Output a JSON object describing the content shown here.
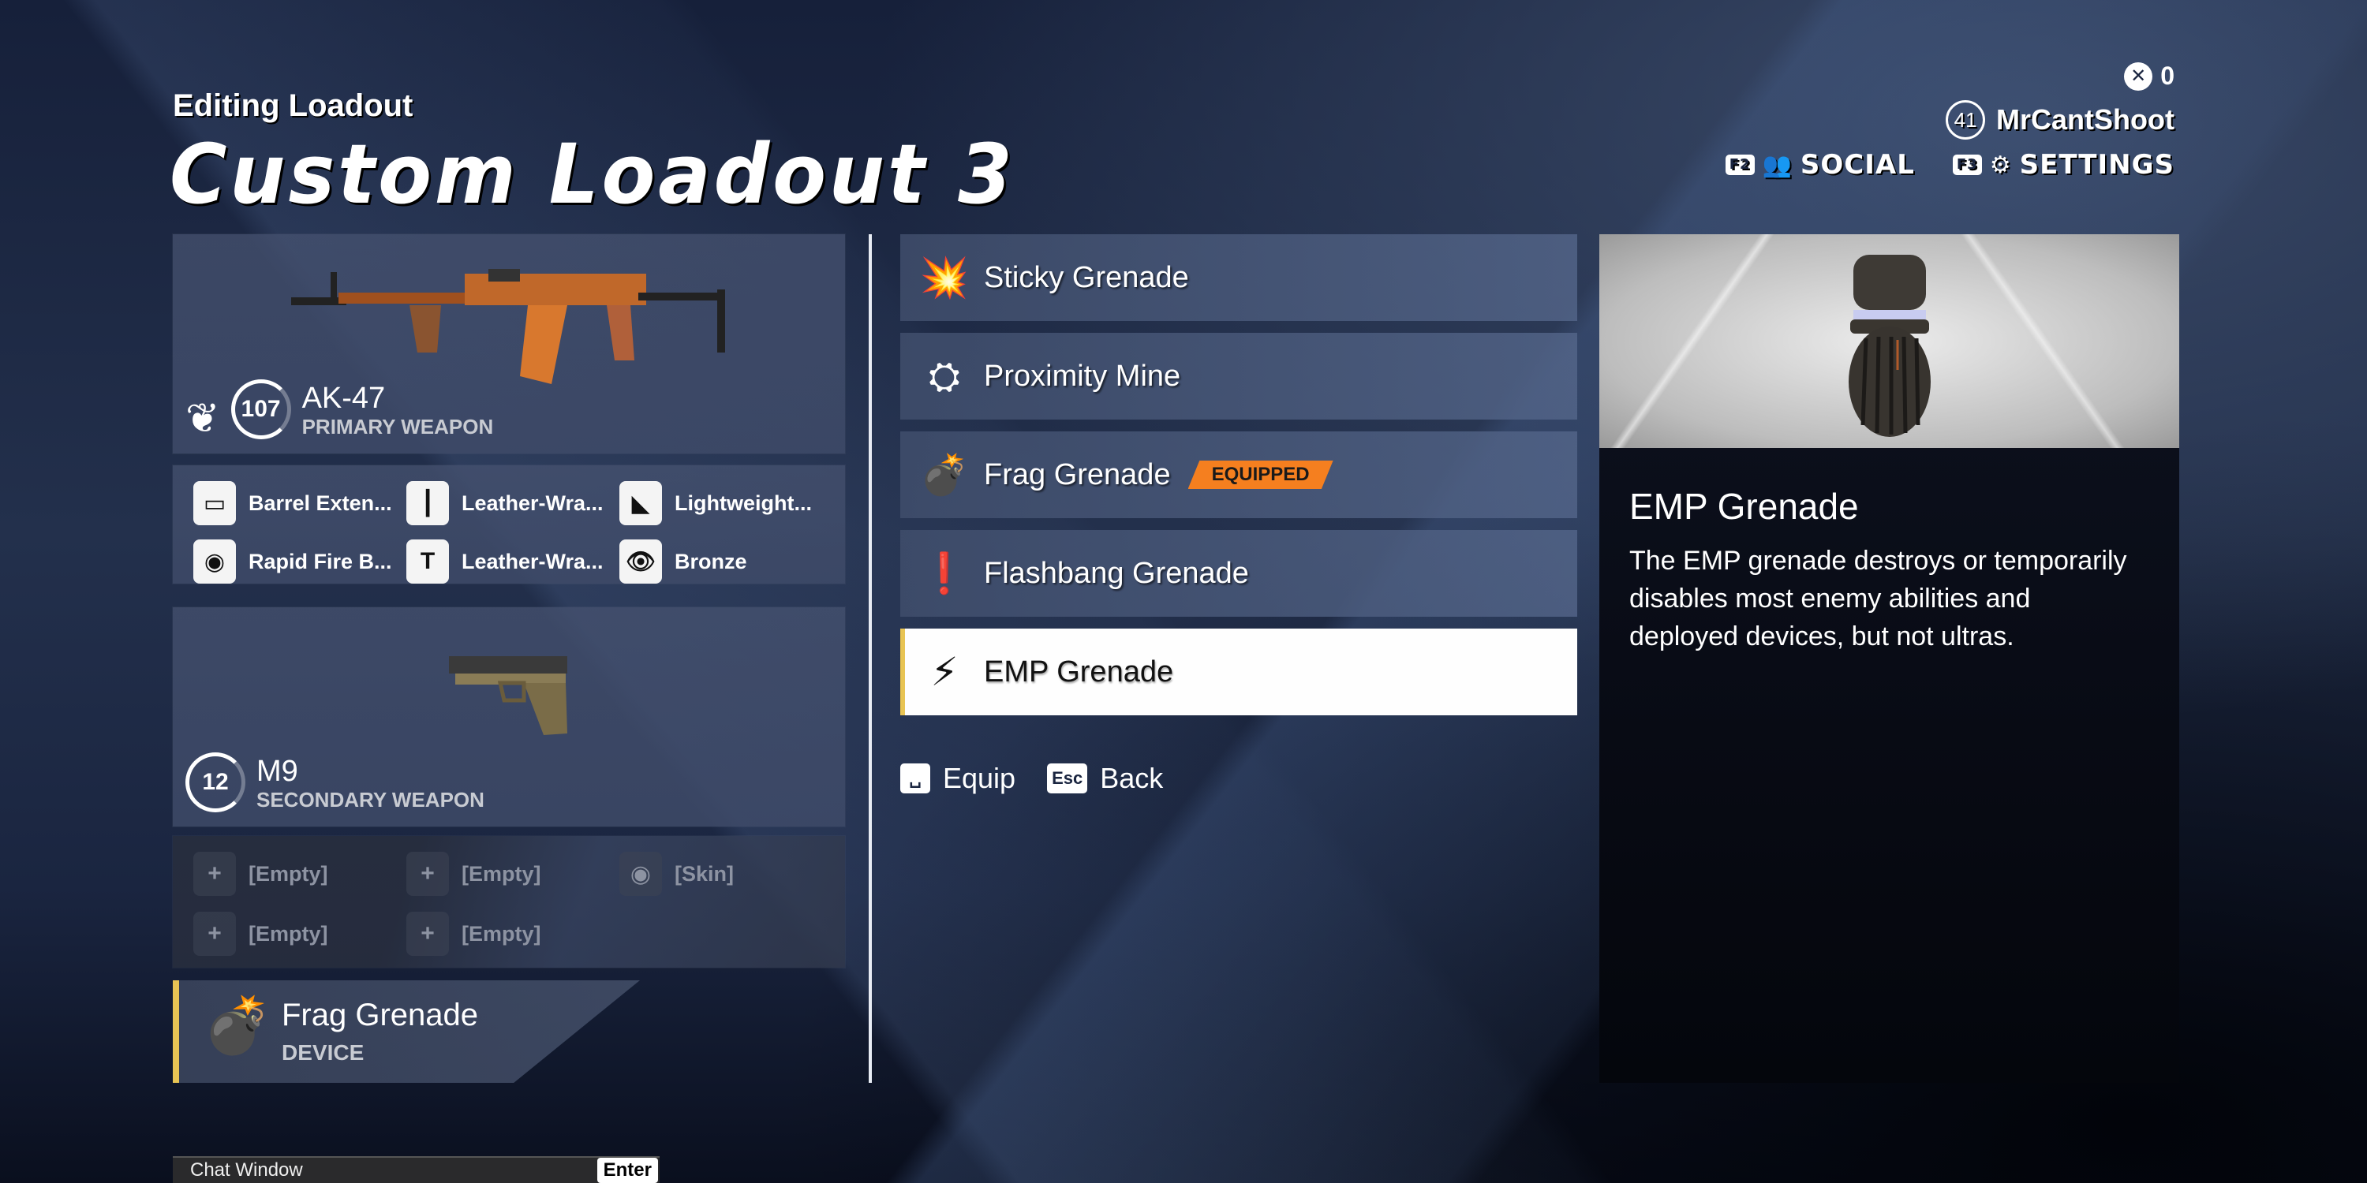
{
  "header": {
    "subtitle": "Editing Loadout",
    "title": "Custom Loadout 3"
  },
  "player": {
    "currency_icon": "x-coin-icon",
    "currency_amount": "0",
    "level": "41",
    "name": "MrCantShoot"
  },
  "nav": [
    {
      "key": "F2",
      "icon": "social-icon",
      "label": "SOCIAL"
    },
    {
      "key": "F3",
      "icon": "gear-icon",
      "label": "SETTINGS"
    }
  ],
  "primary_weapon": {
    "mastery": "1",
    "level": "107",
    "name": "AK-47",
    "type": "PRIMARY WEAPON",
    "attachments": [
      {
        "icon": "barrel-icon",
        "label": "Barrel Exten..."
      },
      {
        "icon": "foregrip-icon",
        "label": "Leather-Wra..."
      },
      {
        "icon": "stock-icon",
        "label": "Lightweight..."
      },
      {
        "icon": "magazine-icon",
        "label": "Rapid Fire B..."
      },
      {
        "icon": "grip-icon",
        "label": "Leather-Wra..."
      },
      {
        "icon": "skin-icon",
        "label": "Bronze"
      }
    ]
  },
  "secondary_weapon": {
    "level": "12",
    "name": "M9",
    "type": "SECONDARY WEAPON",
    "attachments": [
      {
        "icon": "plus-icon",
        "label": "[Empty]"
      },
      {
        "icon": "plus-icon",
        "label": "[Empty]"
      },
      {
        "icon": "skin-icon",
        "label": "[Skin]"
      },
      {
        "icon": "plus-icon",
        "label": "[Empty]"
      },
      {
        "icon": "plus-icon",
        "label": "[Empty]"
      }
    ]
  },
  "device": {
    "name": "Frag Grenade",
    "type": "DEVICE"
  },
  "device_list": [
    {
      "icon": "sticky-grenade-icon",
      "label": "Sticky Grenade",
      "equipped": false,
      "selected": false
    },
    {
      "icon": "proximity-mine-icon",
      "label": "Proximity Mine",
      "equipped": false,
      "selected": false
    },
    {
      "icon": "frag-grenade-icon",
      "label": "Frag Grenade",
      "equipped": true,
      "selected": false
    },
    {
      "icon": "flashbang-grenade-icon",
      "label": "Flashbang Grenade",
      "equipped": false,
      "selected": false
    },
    {
      "icon": "emp-grenade-icon",
      "label": "EMP Grenade",
      "equipped": false,
      "selected": true
    }
  ],
  "equipped_badge": "EQUIPPED",
  "hints": [
    {
      "key": "␣",
      "label": "Equip"
    },
    {
      "key": "Esc",
      "label": "Back"
    }
  ],
  "detail": {
    "title": "EMP Grenade",
    "description": "The EMP grenade destroys or temporarily disables most enemy abilities and deployed devices, but not ultras."
  },
  "chat": {
    "label": "Chat Window",
    "key": "Enter"
  },
  "colors": {
    "accent_yellow": "#e8c454",
    "equipped_orange": "#f57f1f",
    "selected_bg": "#fefefe"
  }
}
